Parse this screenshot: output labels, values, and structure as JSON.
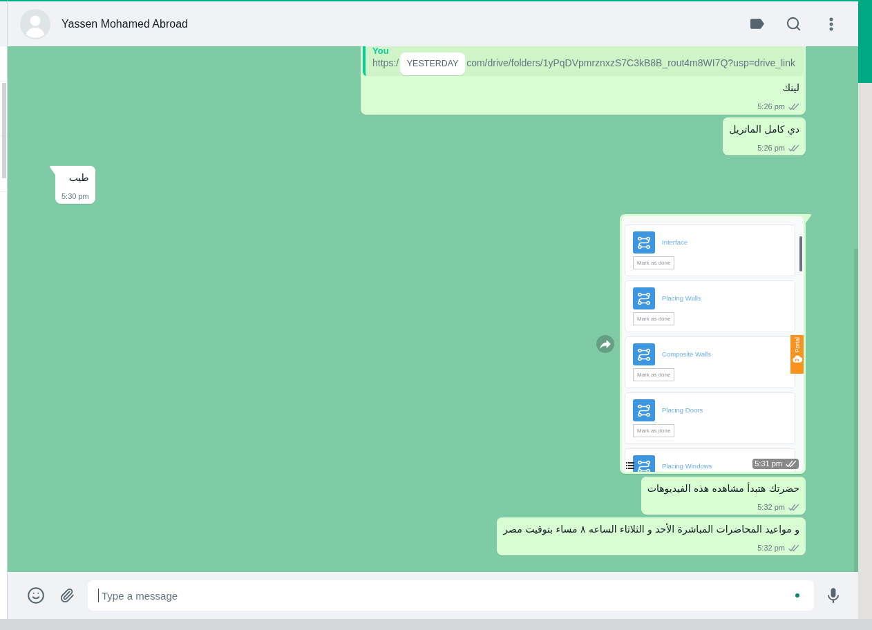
{
  "header": {
    "contact_name": "Yassen Mohamed Abroad"
  },
  "date_chip": "YESTERDAY",
  "messages": [
    {
      "kind": "link",
      "outgoing": true,
      "quote_author": "You",
      "link_start": "https:/",
      "link_end": "com/drive/folders/1yPqDVpmrznxzS7C3kB8B_rout4m8WI7Q?usp=drive_link",
      "text": "لينك",
      "time": "5:26 pm",
      "read": false
    },
    {
      "kind": "text",
      "outgoing": true,
      "text": "دي كامل الماتريل",
      "time": "5:26 pm",
      "read": false
    },
    {
      "kind": "text",
      "outgoing": false,
      "text": "طيب",
      "time": "5:30 pm"
    },
    {
      "kind": "image",
      "outgoing": true,
      "screenshot": {
        "items": [
          {
            "title": "Interface",
            "button": "Mark as done"
          },
          {
            "title": "Placing Walls",
            "button": "Mark as done"
          },
          {
            "title": "Composite Walls",
            "button": "Mark as done"
          },
          {
            "title": "Placing Doors",
            "button": "Mark as done"
          },
          {
            "title": "Placing Windows"
          }
        ],
        "side_tab": "Portal"
      },
      "time": "5:31 pm",
      "read": false
    },
    {
      "kind": "text",
      "outgoing": true,
      "text": "حضرتك هتبدأ مشاهده هذه الفيديوهات",
      "time": "5:32 pm",
      "read": false
    },
    {
      "kind": "text",
      "outgoing": true,
      "text": "و مواعيد المحاضرات المباشرة الأحد و الثلاثاء الساعه ٨ مساء بتوقيت مصر",
      "time": "5:32 pm",
      "read": false
    }
  ],
  "composer": {
    "placeholder": "Type a message"
  }
}
